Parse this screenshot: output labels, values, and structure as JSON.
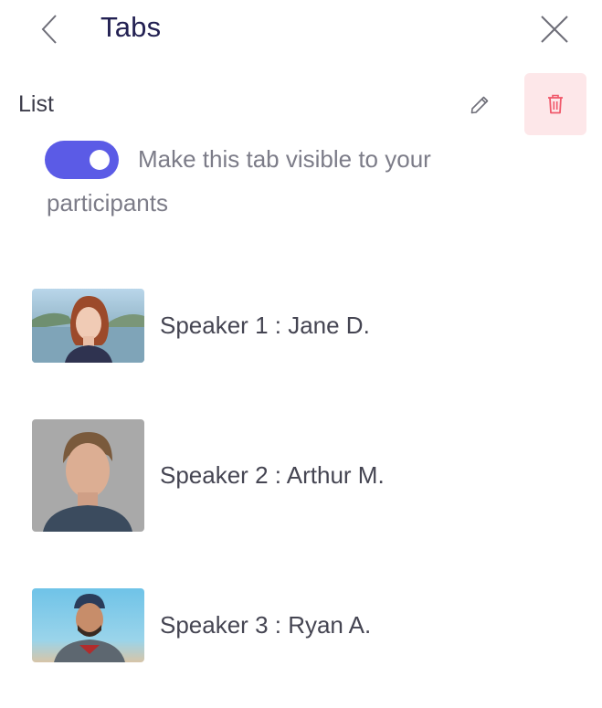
{
  "header": {
    "title": "Tabs",
    "back_icon": "chevron-left-icon",
    "close_icon": "close-icon"
  },
  "section": {
    "label": "List",
    "edit_icon": "pencil-icon",
    "delete_icon": "trash-icon"
  },
  "visibility": {
    "enabled": true,
    "text": "Make this tab visible to your participants"
  },
  "speakers": [
    {
      "label": "Speaker 1 : Jane D.",
      "photo": "speaker-photo-jane"
    },
    {
      "label": "Speaker 2 : Arthur M.",
      "photo": "speaker-photo-arthur"
    },
    {
      "label": "Speaker 3 : Ryan A.",
      "photo": "speaker-photo-ryan"
    }
  ],
  "colors": {
    "title": "#222052",
    "toggle_on": "#5b5be6",
    "delete_bg": "#fde7e9",
    "delete_icon": "#f0596b",
    "text_muted": "#7c7c88"
  }
}
